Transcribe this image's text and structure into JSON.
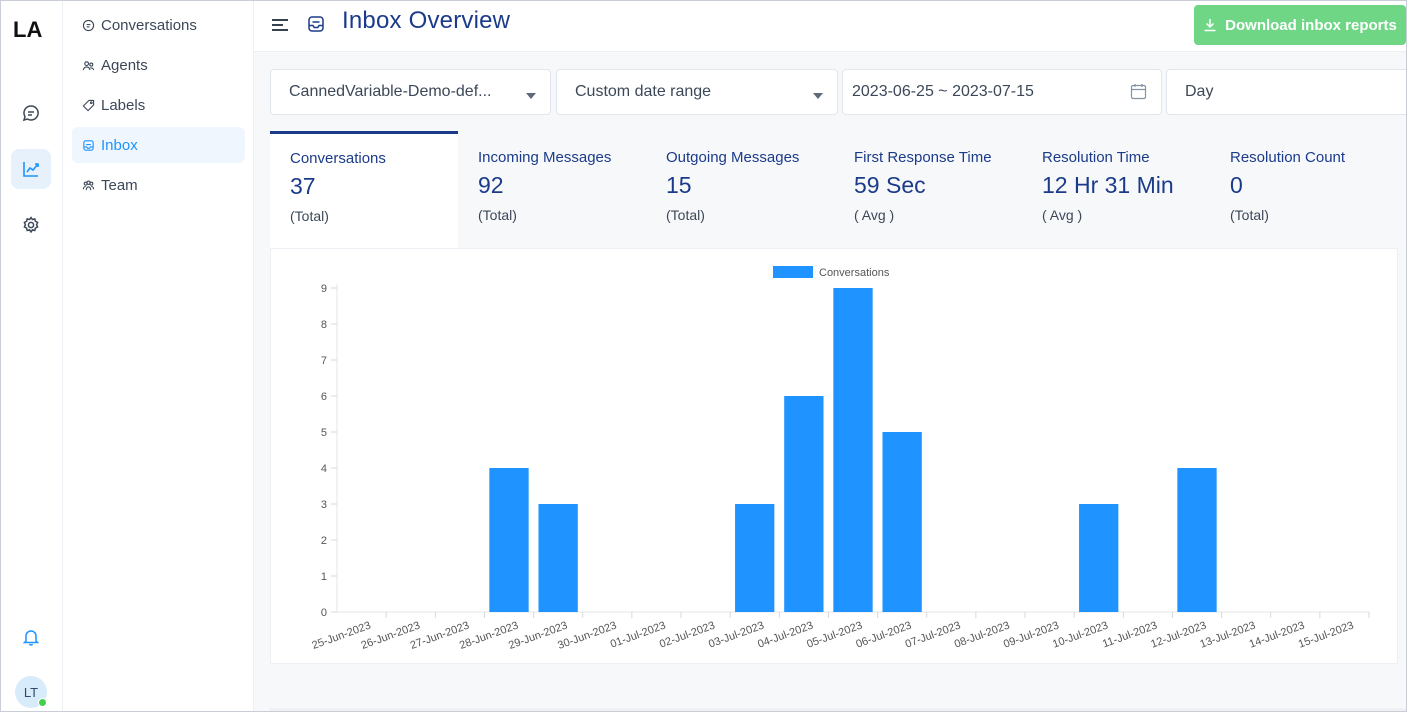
{
  "app": {
    "logo_text": "LA"
  },
  "rail": {
    "items": [
      {
        "name": "conversations",
        "icon": "chat-bubble-icon"
      },
      {
        "name": "reports",
        "icon": "chart-line-icon",
        "active": true
      },
      {
        "name": "settings",
        "icon": "gear-icon"
      }
    ],
    "notifications_icon": "bell-icon",
    "avatar_initials": "LT",
    "presence_color": "#44ce4b"
  },
  "subnav": {
    "items": [
      {
        "label": "Conversations",
        "icon": "chat-icon"
      },
      {
        "label": "Agents",
        "icon": "agents-icon"
      },
      {
        "label": "Labels",
        "icon": "tag-icon"
      },
      {
        "label": "Inbox",
        "icon": "inbox-icon",
        "active": true
      },
      {
        "label": "Team",
        "icon": "team-icon"
      }
    ]
  },
  "header": {
    "title": "Inbox Overview",
    "download_label": "Download inbox reports"
  },
  "filters": {
    "inbox": "CannedVariable-Demo-def...",
    "date_range": "Custom date range",
    "dates": "2023-06-25 ~ 2023-07-15",
    "group_by": "Day"
  },
  "metrics": [
    {
      "label": "Conversations",
      "value": "37",
      "sub": "(Total)",
      "active": true
    },
    {
      "label": "Incoming Messages",
      "value": "92",
      "sub": "(Total)"
    },
    {
      "label": "Outgoing Messages",
      "value": "15",
      "sub": "(Total)"
    },
    {
      "label": "First Response Time",
      "value": "59 Sec",
      "sub": "( Avg )"
    },
    {
      "label": "Resolution Time",
      "value": "12 Hr 31 Min",
      "sub": "( Avg )"
    },
    {
      "label": "Resolution Count",
      "value": "0",
      "sub": "(Total)"
    }
  ],
  "colors": {
    "accent": "#1f93ff",
    "title": "#1b3b8a",
    "download": "#6fd686",
    "bar": "#1f93ff"
  },
  "chart_data": {
    "type": "bar",
    "categories": [
      "25-Jun-2023",
      "26-Jun-2023",
      "27-Jun-2023",
      "28-Jun-2023",
      "29-Jun-2023",
      "30-Jun-2023",
      "01-Jul-2023",
      "02-Jul-2023",
      "03-Jul-2023",
      "04-Jul-2023",
      "05-Jul-2023",
      "06-Jul-2023",
      "07-Jul-2023",
      "08-Jul-2023",
      "09-Jul-2023",
      "10-Jul-2023",
      "11-Jul-2023",
      "12-Jul-2023",
      "13-Jul-2023",
      "14-Jul-2023",
      "15-Jul-2023"
    ],
    "series": [
      {
        "name": "Conversations",
        "values": [
          0,
          0,
          0,
          4,
          3,
          0,
          0,
          0,
          3,
          6,
          9,
          5,
          0,
          0,
          0,
          3,
          0,
          4,
          0,
          0,
          0
        ]
      }
    ],
    "yticks": [
      0,
      1,
      2,
      3,
      4,
      5,
      6,
      7,
      8,
      9
    ],
    "ylim": [
      0,
      9
    ],
    "legend": "top-center",
    "grid": false
  }
}
